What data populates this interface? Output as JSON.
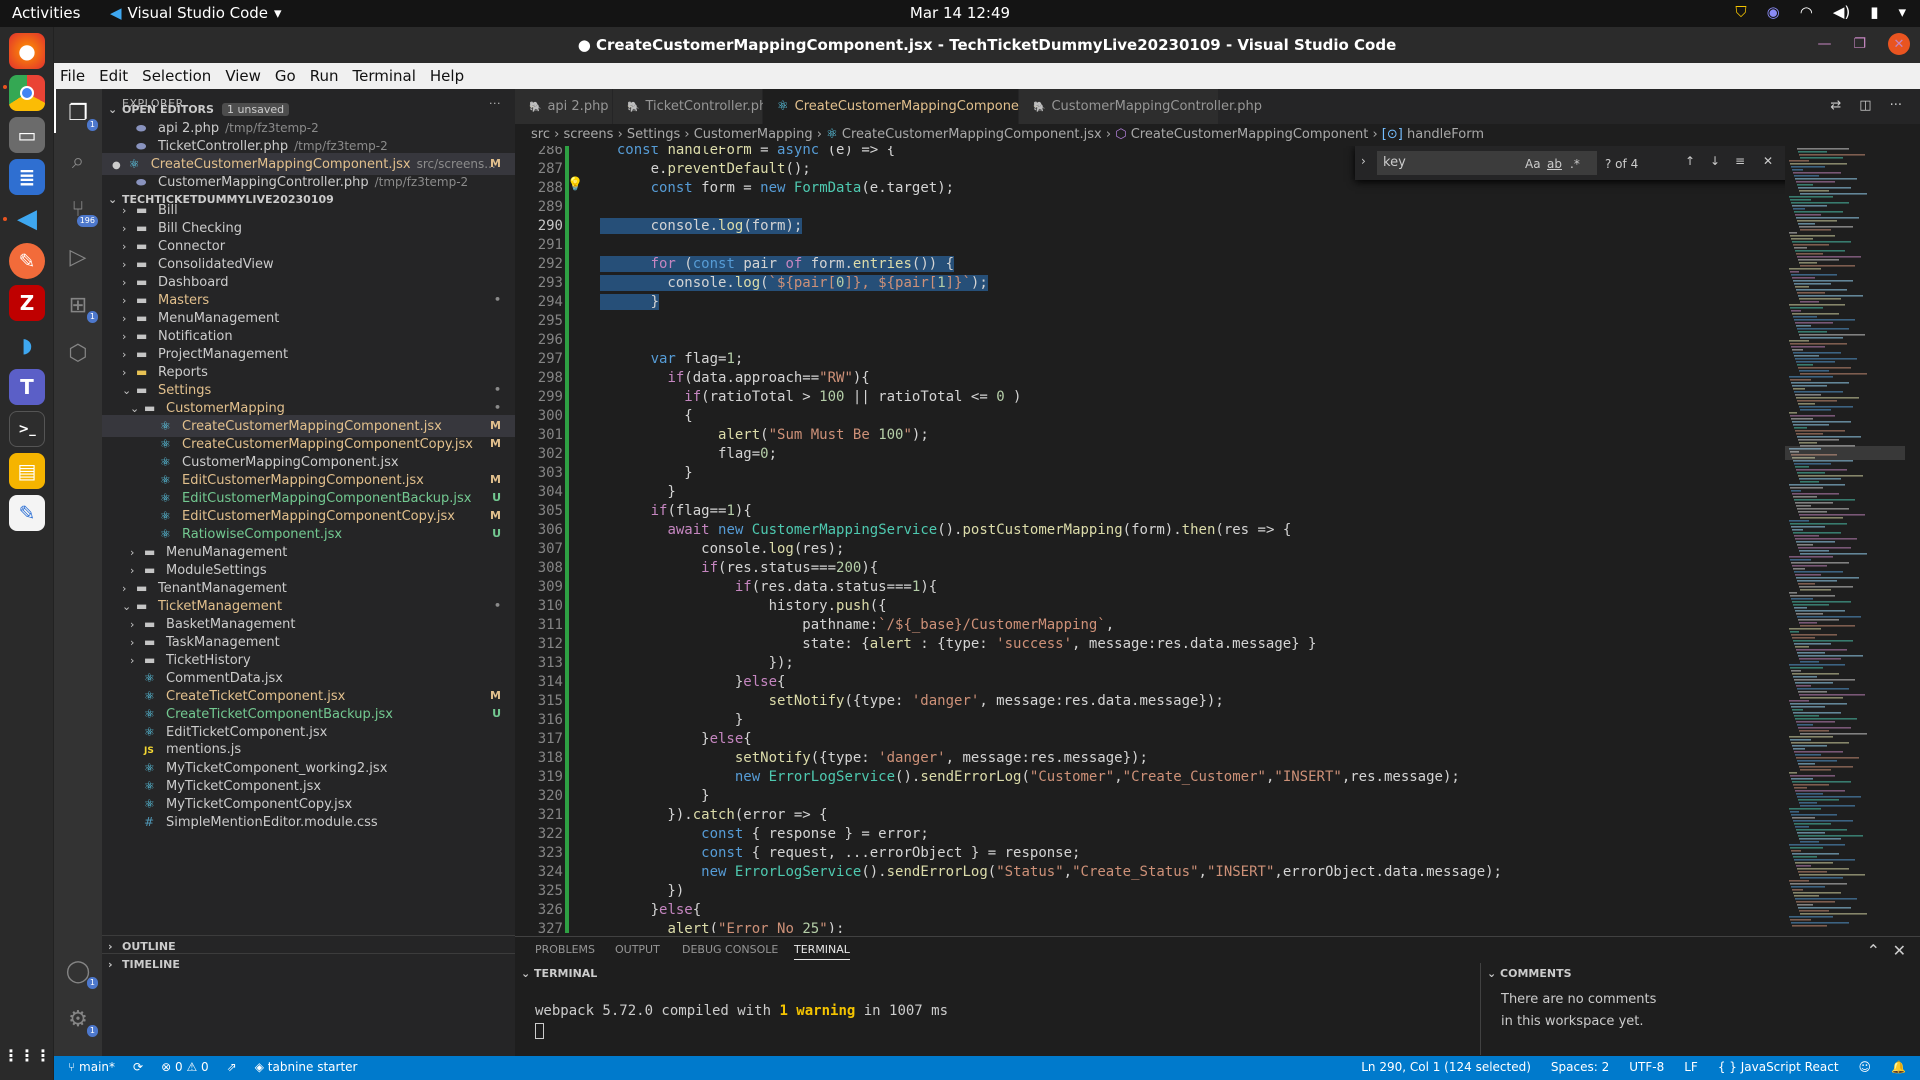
{
  "topbar": {
    "activities": "Activities",
    "app_name": "Visual Studio Code",
    "clock": "Mar 14  12:49"
  },
  "window": {
    "title": "● CreateCustomerMappingComponent.jsx - TechTicketDummyLive20230109 - Visual Studio Code"
  },
  "menu": [
    "File",
    "Edit",
    "Selection",
    "View",
    "Go",
    "Run",
    "Terminal",
    "Help"
  ],
  "activity_badges": {
    "explorer": "1",
    "scm": "196",
    "extensions": "1",
    "accounts": "1",
    "settings": "1"
  },
  "explorer": {
    "header": "EXPLORER",
    "open_editors_label": "OPEN EDITORS",
    "unsaved_badge": "1 unsaved",
    "open_editors": [
      {
        "name": "api 2.php",
        "desc": "/tmp/fz3temp-2",
        "status": ""
      },
      {
        "name": "TicketController.php",
        "desc": "/tmp/fz3temp-2",
        "status": ""
      },
      {
        "name": "CreateCustomerMappingComponent.jsx",
        "desc": "src/screens...",
        "status": "M"
      },
      {
        "name": "CustomerMappingController.php",
        "desc": "/tmp/fz3temp-2",
        "status": ""
      }
    ],
    "workspace_label": "TECHTICKETDUMMYLIVE20230109",
    "tree": [
      {
        "name": "Bill",
        "depth": 1,
        "type": "folder",
        "status": ""
      },
      {
        "name": "Bill Checking",
        "depth": 1,
        "type": "folder",
        "status": ""
      },
      {
        "name": "Connector",
        "depth": 1,
        "type": "folder",
        "status": ""
      },
      {
        "name": "ConsolidatedView",
        "depth": 1,
        "type": "folder",
        "status": ""
      },
      {
        "name": "Dashboard",
        "depth": 1,
        "type": "folder",
        "status": ""
      },
      {
        "name": "Masters",
        "depth": 1,
        "type": "folder",
        "status": "•"
      },
      {
        "name": "MenuManagement",
        "depth": 1,
        "type": "folder",
        "status": ""
      },
      {
        "name": "Notification",
        "depth": 1,
        "type": "folder",
        "status": ""
      },
      {
        "name": "ProjectManagement",
        "depth": 1,
        "type": "folder",
        "status": ""
      },
      {
        "name": "Reports",
        "depth": 1,
        "type": "folder-y",
        "status": ""
      },
      {
        "name": "Settings",
        "depth": 1,
        "type": "folder-open",
        "status": "•"
      },
      {
        "name": "CustomerMapping",
        "depth": 2,
        "type": "folder-open",
        "status": "•"
      },
      {
        "name": "CreateCustomerMappingComponent.jsx",
        "depth": 3,
        "type": "react",
        "status": "M"
      },
      {
        "name": "CreateCustomerMappingComponentCopy.jsx",
        "depth": 3,
        "type": "react",
        "status": "M"
      },
      {
        "name": "CustomerMappingComponent.jsx",
        "depth": 3,
        "type": "react",
        "status": ""
      },
      {
        "name": "EditCustomerMappingComponent.jsx",
        "depth": 3,
        "type": "react",
        "status": "M"
      },
      {
        "name": "EditCustomerMappingComponentBackup.jsx",
        "depth": 3,
        "type": "react",
        "status": "U"
      },
      {
        "name": "EditCustomerMappingComponentCopy.jsx",
        "depth": 3,
        "type": "react",
        "status": "M"
      },
      {
        "name": "RatiowiseComponent.jsx",
        "depth": 3,
        "type": "react",
        "status": "U"
      },
      {
        "name": "MenuManagement",
        "depth": 2,
        "type": "folder",
        "status": ""
      },
      {
        "name": "ModuleSettings",
        "depth": 2,
        "type": "folder",
        "status": ""
      },
      {
        "name": "TenantManagement",
        "depth": 1,
        "type": "folder",
        "status": ""
      },
      {
        "name": "TicketManagement",
        "depth": 1,
        "type": "folder-open",
        "status": "•"
      },
      {
        "name": "BasketManagement",
        "depth": 2,
        "type": "folder",
        "status": ""
      },
      {
        "name": "TaskManagement",
        "depth": 2,
        "type": "folder",
        "status": ""
      },
      {
        "name": "TicketHistory",
        "depth": 2,
        "type": "folder",
        "status": ""
      },
      {
        "name": "CommentData.jsx",
        "depth": 2,
        "type": "react",
        "status": ""
      },
      {
        "name": "CreateTicketComponent.jsx",
        "depth": 2,
        "type": "react",
        "status": "M"
      },
      {
        "name": "CreateTicketComponentBackup.jsx",
        "depth": 2,
        "type": "react",
        "status": "U"
      },
      {
        "name": "EditTicketComponent.jsx",
        "depth": 2,
        "type": "react",
        "status": ""
      },
      {
        "name": "mentions.js",
        "depth": 2,
        "type": "js",
        "status": ""
      },
      {
        "name": "MyTicketComponent_working2.jsx",
        "depth": 2,
        "type": "react",
        "status": ""
      },
      {
        "name": "MyTicketComponent.jsx",
        "depth": 2,
        "type": "react",
        "status": ""
      },
      {
        "name": "MyTicketComponentCopy.jsx",
        "depth": 2,
        "type": "react",
        "status": ""
      },
      {
        "name": "SimpleMentionEditor.module.css",
        "depth": 2,
        "type": "css",
        "status": ""
      }
    ],
    "outline_label": "OUTLINE",
    "timeline_label": "TIMELINE"
  },
  "tabs": [
    {
      "label": "api 2.php",
      "active": false
    },
    {
      "label": "TicketController.php",
      "active": false
    },
    {
      "label": "CreateCustomerMappingComponent.jsx",
      "suffix": "M",
      "active": true
    },
    {
      "label": "CustomerMappingController.php",
      "active": false
    }
  ],
  "breadcrumb": [
    "src",
    "screens",
    "Settings",
    "CustomerMapping",
    "CreateCustomerMappingComponent.jsx",
    "CreateCustomerMappingComponent",
    "handleForm"
  ],
  "find": {
    "value": "key",
    "count": "? of 4",
    "opt_case": "Aa",
    "opt_word": "ab",
    "opt_regex": ".*"
  },
  "editor": {
    "current_line": 290,
    "lines": [
      {
        "n": 286,
        "code": "  const handleForm = async (e) => {"
      },
      {
        "n": 287,
        "code": "      e.preventDefault();"
      },
      {
        "n": 288,
        "code": "      const form = new FormData(e.target);"
      },
      {
        "n": 289,
        "code": ""
      },
      {
        "n": 290,
        "code": "      console.log(form);"
      },
      {
        "n": 291,
        "code": ""
      },
      {
        "n": 292,
        "code": "      for (const pair of form.entries()) {"
      },
      {
        "n": 293,
        "code": "        console.log(`${pair[0]}, ${pair[1]}`);"
      },
      {
        "n": 294,
        "code": "      }"
      },
      {
        "n": 295,
        "code": ""
      },
      {
        "n": 296,
        "code": ""
      },
      {
        "n": 297,
        "code": "      var flag=1;"
      },
      {
        "n": 298,
        "code": "        if(data.approach==\"RW\"){"
      },
      {
        "n": 299,
        "code": "          if(ratioTotal > 100 || ratioTotal <= 0 )"
      },
      {
        "n": 300,
        "code": "          {"
      },
      {
        "n": 301,
        "code": "              alert(\"Sum Must Be 100\");"
      },
      {
        "n": 302,
        "code": "              flag=0;"
      },
      {
        "n": 303,
        "code": "          }"
      },
      {
        "n": 304,
        "code": "        }"
      },
      {
        "n": 305,
        "code": "      if(flag==1){"
      },
      {
        "n": 306,
        "code": "        await new CustomerMappingService().postCustomerMapping(form).then(res => {"
      },
      {
        "n": 307,
        "code": "            console.log(res);"
      },
      {
        "n": 308,
        "code": "            if(res.status===200){"
      },
      {
        "n": 309,
        "code": "                if(res.data.status===1){"
      },
      {
        "n": 310,
        "code": "                    history.push({"
      },
      {
        "n": 311,
        "code": "                        pathname:`/${_base}/CustomerMapping`,"
      },
      {
        "n": 312,
        "code": "                        state: {alert : {type: 'success', message:res.data.message} }"
      },
      {
        "n": 313,
        "code": "                    });"
      },
      {
        "n": 314,
        "code": "                }else{"
      },
      {
        "n": 315,
        "code": "                    setNotify({type: 'danger', message:res.data.message});"
      },
      {
        "n": 316,
        "code": "                }"
      },
      {
        "n": 317,
        "code": "            }else{"
      },
      {
        "n": 318,
        "code": "                setNotify({type: 'danger', message:res.message});"
      },
      {
        "n": 319,
        "code": "                new ErrorLogService().sendErrorLog(\"Customer\",\"Create_Customer\",\"INSERT\",res.message);"
      },
      {
        "n": 320,
        "code": "            }"
      },
      {
        "n": 321,
        "code": "        }).catch(error => {"
      },
      {
        "n": 322,
        "code": "            const { response } = error;"
      },
      {
        "n": 323,
        "code": "            const { request, ...errorObject } = response;"
      },
      {
        "n": 324,
        "code": "            new ErrorLogService().sendErrorLog(\"Status\",\"Create_Status\",\"INSERT\",errorObject.data.message);"
      },
      {
        "n": 325,
        "code": "        })"
      },
      {
        "n": 326,
        "code": "      }else{"
      },
      {
        "n": 327,
        "code": "        alert(\"Error No 25\");"
      }
    ]
  },
  "panel": {
    "tabs": [
      "PROBLEMS",
      "OUTPUT",
      "DEBUG CONSOLE",
      "TERMINAL"
    ],
    "active_tab": "TERMINAL",
    "terminal_header": "TERMINAL",
    "terminal_pre": "webpack 5.72.0 compiled with ",
    "terminal_warn": "1 warning",
    "terminal_post": " in 1007 ms",
    "comments_header": "COMMENTS",
    "comments_text": "There are no comments in this workspace yet."
  },
  "status": {
    "branch": "main*",
    "errors": "0",
    "warnings": "0",
    "tabnine": "tabnine starter",
    "position": "Ln 290, Col 1 (124 selected)",
    "spaces": "Spaces: 2",
    "encoding": "UTF-8",
    "eol": "LF",
    "language": "JavaScript React"
  }
}
